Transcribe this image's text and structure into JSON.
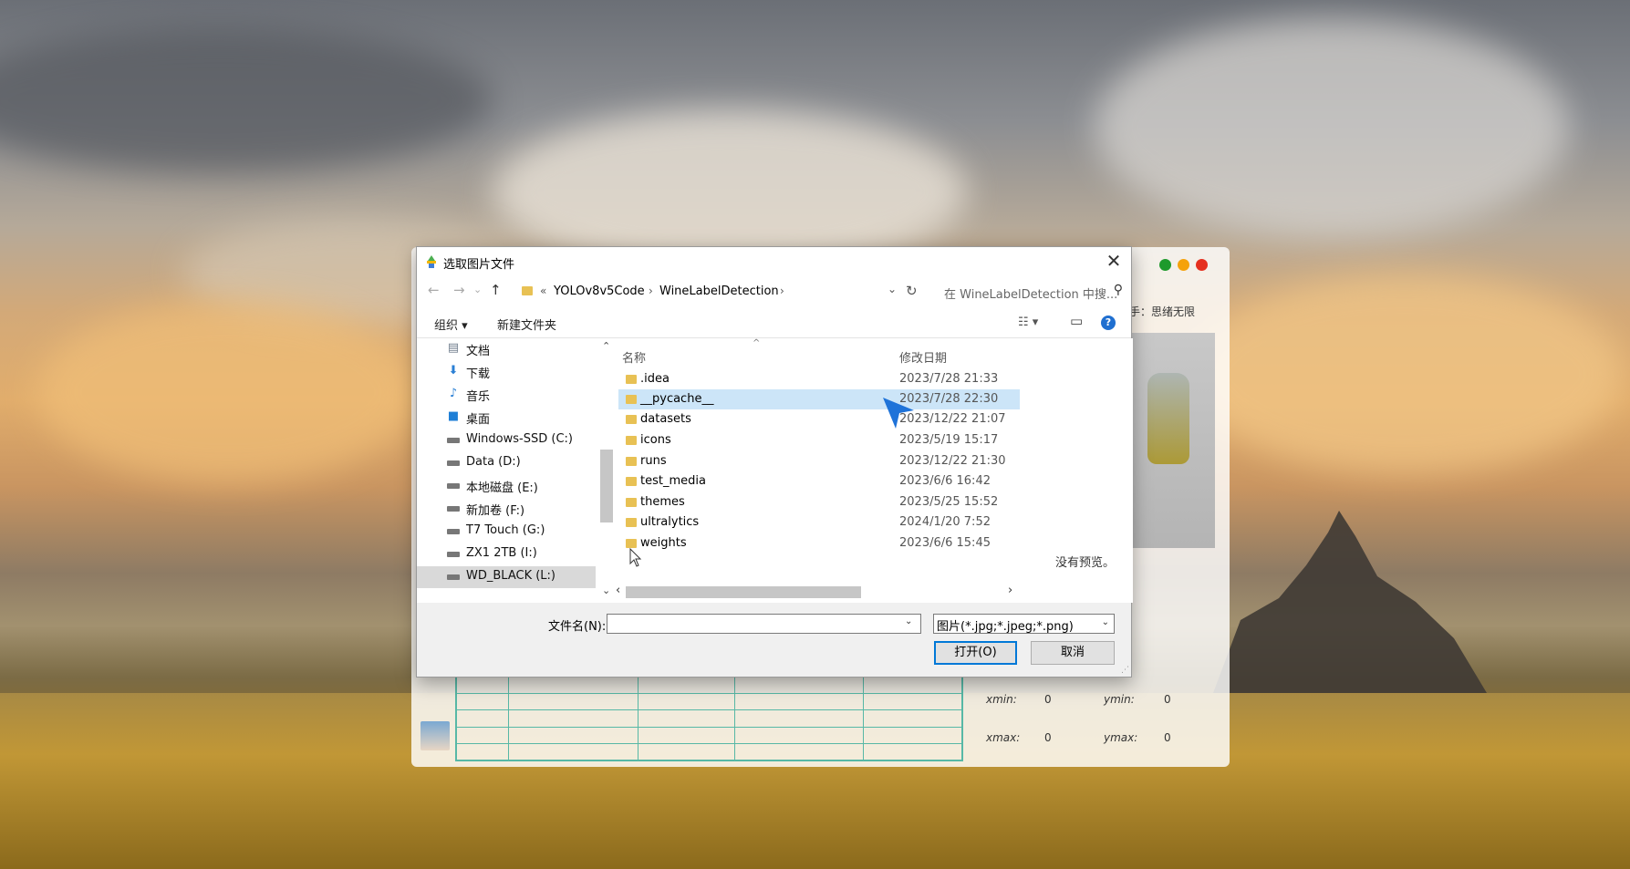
{
  "app_window": {
    "author_label": "手：思绪无限",
    "xmin_label": "xmin:",
    "xmin_value": "0",
    "ymin_label": "ymin:",
    "ymin_value": "0",
    "xmax_label": "xmax:",
    "xmax_value": "0",
    "ymax_label": "ymax:",
    "ymax_value": "0",
    "window_button_colors": [
      "#1e9a2c",
      "#f5a20b",
      "#e5301f"
    ]
  },
  "dialog": {
    "title": "选取图片文件",
    "close_icon": "✕",
    "address": {
      "back_icon": "←",
      "forward_icon": "→",
      "recent_icon": "⌄",
      "up_icon": "↑",
      "prefix": "«",
      "crumbs": [
        "YOLOv8v5Code",
        "WineLabelDetection"
      ],
      "separator": "›",
      "dropdown_icon": "⌄",
      "refresh_icon": "↻",
      "search_placeholder": "在 WineLabelDetection 中搜...",
      "search_icon": "⚲"
    },
    "toolbar": {
      "organize": "组织 ▾",
      "new_folder": "新建文件夹",
      "view_icon": "☷ ▾",
      "preview_pane_icon": "▭",
      "help_icon": "?"
    },
    "nav_pane": {
      "items": [
        {
          "label": "文档",
          "icon": "document-icon"
        },
        {
          "label": "下载",
          "icon": "download-icon"
        },
        {
          "label": "音乐",
          "icon": "music-icon"
        },
        {
          "label": "桌面",
          "icon": "desktop-icon"
        },
        {
          "label": "Windows-SSD (C:)",
          "icon": "drive-icon"
        },
        {
          "label": "Data (D:)",
          "icon": "drive-icon"
        },
        {
          "label": "本地磁盘 (E:)",
          "icon": "drive-icon"
        },
        {
          "label": "新加卷 (F:)",
          "icon": "drive-icon"
        },
        {
          "label": "T7 Touch (G:)",
          "icon": "drive-icon"
        },
        {
          "label": "ZX1 2TB (I:)",
          "icon": "drive-icon"
        },
        {
          "label": "WD_BLACK (L:)",
          "icon": "drive-icon"
        }
      ],
      "selected": "WD_BLACK (L:)",
      "scroll_up_icon": "⌃",
      "scroll_down_icon": "⌄"
    },
    "file_list": {
      "columns": {
        "name": "名称",
        "modified": "修改日期"
      },
      "sort_icon": "^",
      "rows": [
        {
          "name": ".idea",
          "date": "2023/7/28 21:33"
        },
        {
          "name": "__pycache__",
          "date": "2023/7/28 22:30"
        },
        {
          "name": "datasets",
          "date": "2023/12/22 21:07"
        },
        {
          "name": "icons",
          "date": "2023/5/19 15:17"
        },
        {
          "name": "runs",
          "date": "2023/12/22 21:30"
        },
        {
          "name": "test_media",
          "date": "2023/6/6 16:42"
        },
        {
          "name": "themes",
          "date": "2023/5/25 15:52"
        },
        {
          "name": "ultralytics",
          "date": "2024/1/20 7:52"
        },
        {
          "name": "weights",
          "date": "2023/6/6 15:45"
        }
      ],
      "selected": "__pycache__",
      "selection_color": "#cce5f8",
      "no_preview": "没有预览。",
      "scroll_left_icon": "‹",
      "scroll_right_icon": "›"
    },
    "footer": {
      "filename_label": "文件名(N):",
      "filename_value": "",
      "filename_dropdown_icon": "⌄",
      "filter_value": "图片(*.jpg;*.jpeg;*.png)",
      "filter_dropdown_icon": "⌄",
      "open_label": "打开(O)",
      "cancel_label": "取消",
      "accent_color": "#0078d7"
    }
  }
}
